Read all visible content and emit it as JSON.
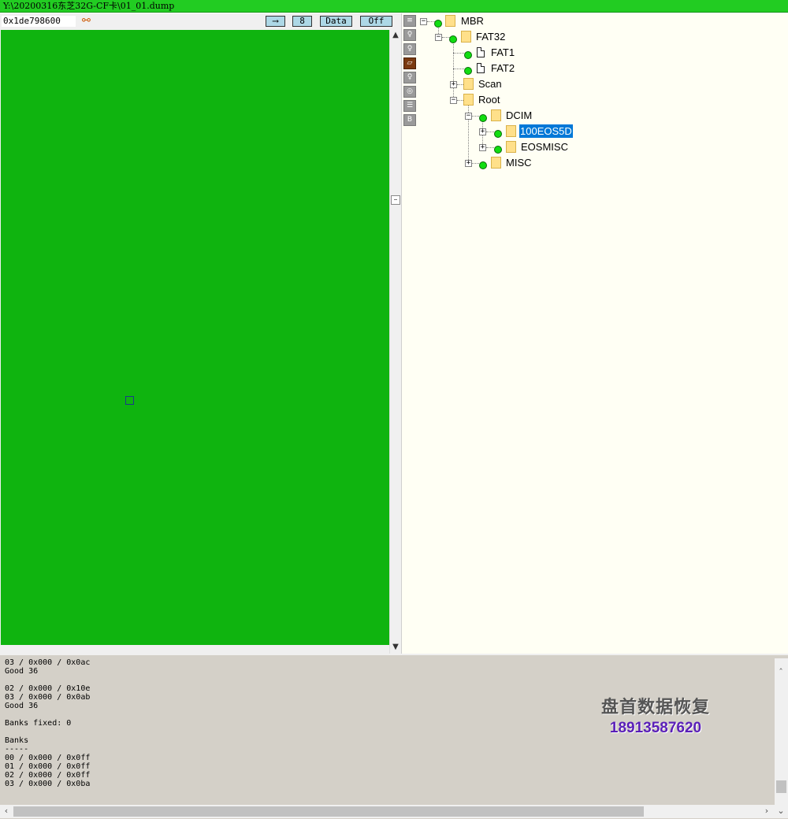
{
  "window": {
    "title": "Y:\\20200316东芝32G-CF卡\\01_01.dump"
  },
  "toolbar": {
    "address": "0x1de798600",
    "link_icon": "chain-link-icon",
    "arrow_button": "⟶",
    "size_button": "8",
    "mode_button": "Data",
    "toggle_button": "Off"
  },
  "sector_map": {
    "status_color": "#0fb40f",
    "current_cell_color": "#1a3a8a"
  },
  "side_icons": [
    "list-icon",
    "lightbulb-icon",
    "lightbulb-icon",
    "map-icon",
    "lightbulb-icon",
    "eye-icon",
    "document-icon",
    "bold-b-icon"
  ],
  "tree": {
    "nodes": [
      {
        "label": "MBR",
        "icon": "folder-icon",
        "status": "green"
      },
      {
        "label": "FAT32",
        "icon": "folder-icon",
        "status": "green"
      },
      {
        "label": "FAT1",
        "icon": "file-icon",
        "status": "green"
      },
      {
        "label": "FAT2",
        "icon": "file-icon",
        "status": "green"
      },
      {
        "label": "Scan",
        "icon": "folder-icon"
      },
      {
        "label": "Root",
        "icon": "folder-icon"
      },
      {
        "label": "DCIM",
        "icon": "folder-icon",
        "status": "green"
      },
      {
        "label": "100EOS5D",
        "icon": "folder-icon",
        "status": "green",
        "selected": true
      },
      {
        "label": "EOSMISC",
        "icon": "folder-icon",
        "status": "green"
      },
      {
        "label": "MISC",
        "icon": "folder-icon",
        "status": "green"
      }
    ]
  },
  "log": {
    "text": "03 / 0x000 / 0x0ac\nGood 36\n\n02 / 0x000 / 0x10e\n03 / 0x000 / 0x0ab\nGood 36\n\nBanks fixed: 0\n\nBanks\n-----\n00 / 0x000 / 0x0ff\n01 / 0x000 / 0x0ff\n02 / 0x000 / 0x0ff\n03 / 0x000 / 0x0ba"
  },
  "watermark": {
    "line1": "盘首数据恢复",
    "line2": "18913587620"
  },
  "colors": {
    "titlebar": "#22cc22",
    "sector_good": "#0fb40f",
    "tree_background": "#fffff4",
    "log_background": "#d4d0c8",
    "selection": "#0078d7",
    "status_dot": "#11dd11"
  }
}
